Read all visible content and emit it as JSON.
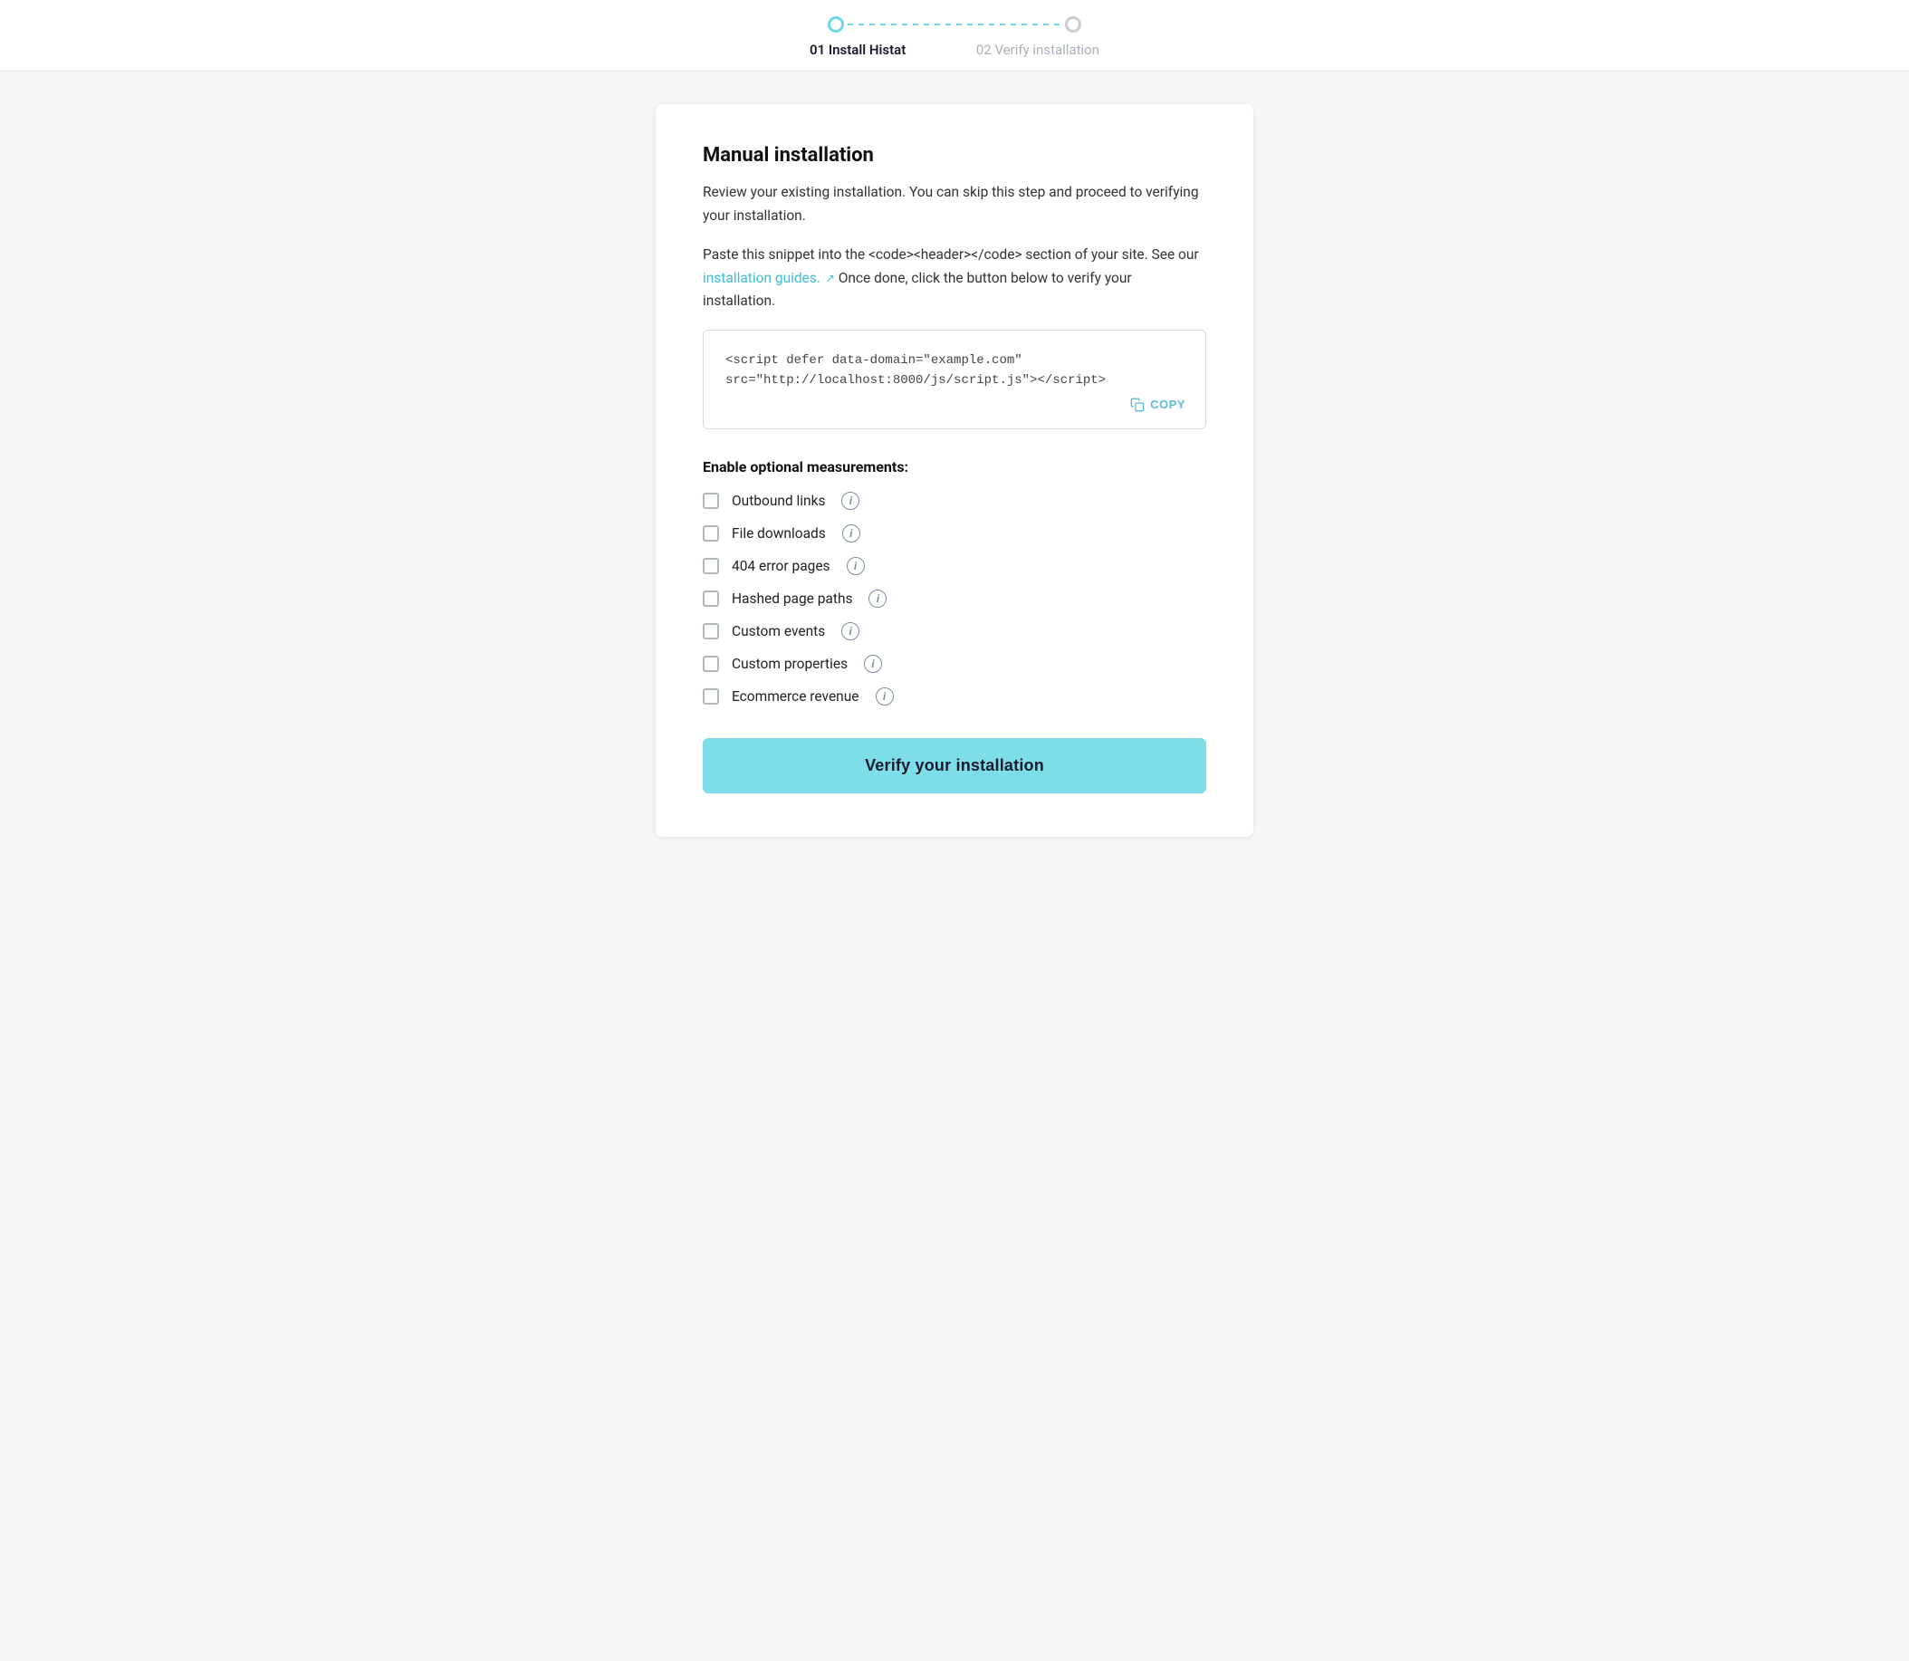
{
  "stepper": {
    "step1_label": "01 Install Histat",
    "step2_label": "02 Verify installation"
  },
  "card": {
    "title": "Manual installation",
    "description1": "Review your existing installation. You can skip this step and proceed to verifying your installation.",
    "description2_pre": "Paste this snippet into the <code><header></code> section of your site. See our ",
    "description2_link": "installation guides.",
    "description2_post": " Once done, click the button below to verify your installation.",
    "code_snippet": "<script defer data-domain=\"example.com\"\nsrc=\"http://localhost:8000/js/script.js\"></script>",
    "copy_label": "COPY",
    "measurements_title": "Enable optional measurements:",
    "checkboxes": [
      {
        "id": "outbound",
        "label": "Outbound links",
        "checked": false
      },
      {
        "id": "file_downloads",
        "label": "File downloads",
        "checked": false
      },
      {
        "id": "error_pages",
        "label": "404 error pages",
        "checked": false
      },
      {
        "id": "hashed_paths",
        "label": "Hashed page paths",
        "checked": false
      },
      {
        "id": "custom_events",
        "label": "Custom events",
        "checked": false
      },
      {
        "id": "custom_props",
        "label": "Custom properties",
        "checked": false
      },
      {
        "id": "ecommerce",
        "label": "Ecommerce revenue",
        "checked": false
      }
    ],
    "verify_button": "Verify your installation"
  }
}
